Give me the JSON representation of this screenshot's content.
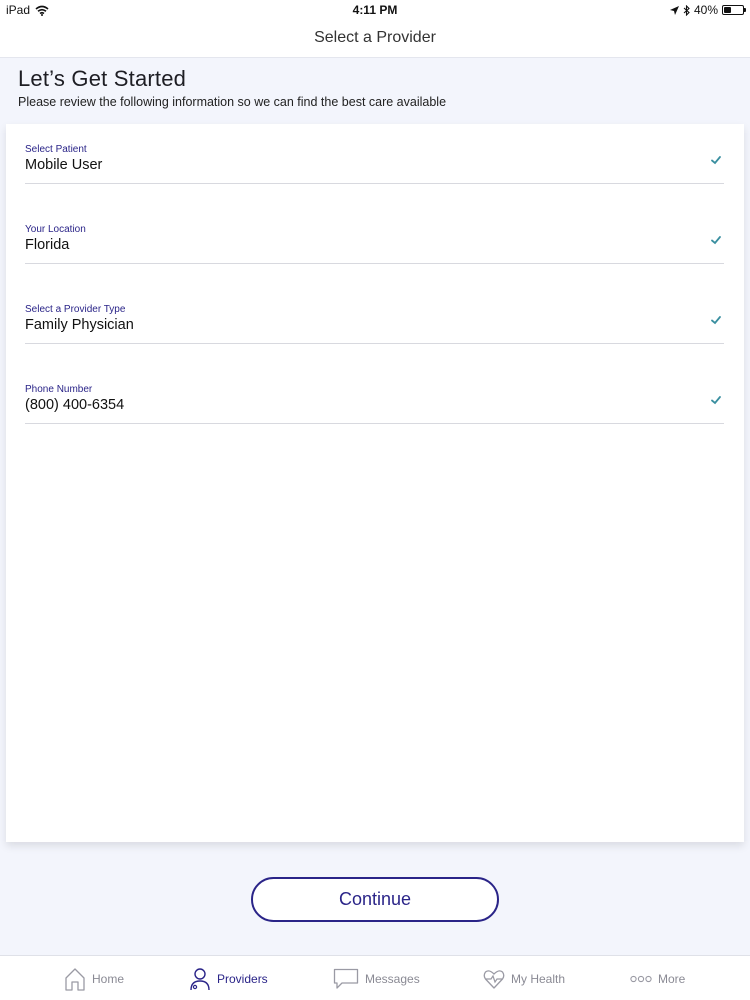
{
  "status_bar": {
    "device": "iPad",
    "time": "4:11 PM",
    "battery": "40%",
    "battery_level": 0.4
  },
  "nav_bar": {
    "title": "Select a Provider"
  },
  "header": {
    "title": "Let’s Get Started",
    "subtitle": "Please review the following information so we can find the best care available"
  },
  "form": {
    "fields": [
      {
        "label": "Select Patient",
        "value": "Mobile User"
      },
      {
        "label": "Your Location",
        "value": "Florida"
      },
      {
        "label": "Select a Provider Type",
        "value": "Family Physician"
      },
      {
        "label": "Phone Number",
        "value": "(800) 400-6354"
      }
    ]
  },
  "continue_label": "Continue",
  "tab_bar": {
    "tabs": [
      {
        "label": "Home",
        "icon": "home-icon"
      },
      {
        "label": "Providers",
        "icon": "person-icon",
        "active": true
      },
      {
        "label": "Messages",
        "icon": "chat-icon"
      },
      {
        "label": "My Health",
        "icon": "heart-icon"
      },
      {
        "label": "More",
        "icon": "more-icon"
      }
    ]
  },
  "colors": {
    "accent": "#2a2488",
    "check": "#3a8fa0",
    "background": "#f3f5fc",
    "inactive_tab": "#8a8a94"
  }
}
